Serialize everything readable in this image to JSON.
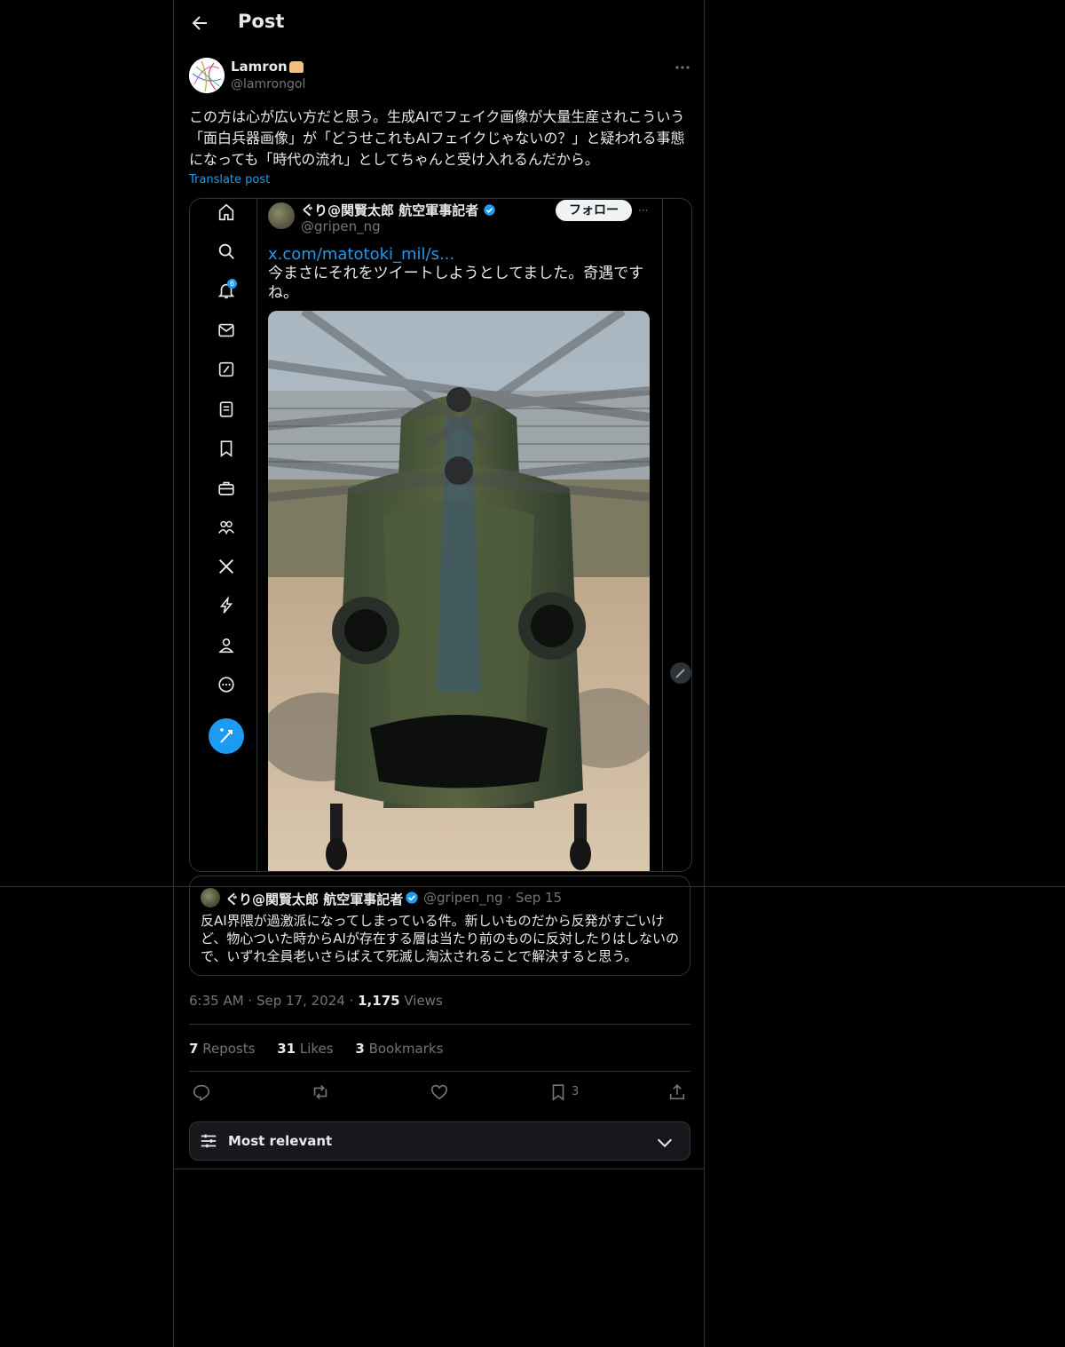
{
  "header": {
    "title": "Post"
  },
  "post": {
    "author_name": "Lamron",
    "author_handle": "@lamrongol",
    "text": "この方は心が広い方だと思う。生成AIでフェイク画像が大量生産されこういう「面白兵器画像」が「どうせこれもAIフェイクじゃないの？」と疑われる事態になっても「時代の流れ」としてちゃんと受け入れるんだから。",
    "translate_label": "Translate post",
    "time": "6:35 AM",
    "date": "Sep 17, 2024",
    "views_count": "1,175",
    "views_label": "Views"
  },
  "media": {
    "notification_badge": "6",
    "inner_name": "ぐり@関賢太郎 航空軍事記者",
    "inner_handle": "@gripen_ng",
    "follow_label": "フォロー",
    "inner_more": "···",
    "inner_link": "x.com/matotoki_mil/s...",
    "inner_text": "今まさにそれをツイートしようとしてました。奇遇ですね。"
  },
  "quote": {
    "name": "ぐり@関賢太郎 航空軍事記者",
    "handle": "@gripen_ng",
    "date": "Sep 15",
    "text": "反AI界隈が過激派になってしまっている件。新しいものだから反発がすごいけど、物心ついた時からAIが存在する層は当たり前のものに反対したりはしないので、いずれ全員老いさらばえて死滅し淘汰されることで解決すると思う。"
  },
  "stats": {
    "reposts_count": "7",
    "reposts_label": "Reposts",
    "likes_count": "31",
    "likes_label": "Likes",
    "bookmarks_count": "3",
    "bookmarks_label": "Bookmarks"
  },
  "actions": {
    "bookmark_count": "3"
  },
  "sort": {
    "label": "Most relevant"
  },
  "colors": {
    "accent": "#1d9bf0",
    "background": "#000000",
    "border": "#2f3336",
    "muted": "#71767b"
  }
}
